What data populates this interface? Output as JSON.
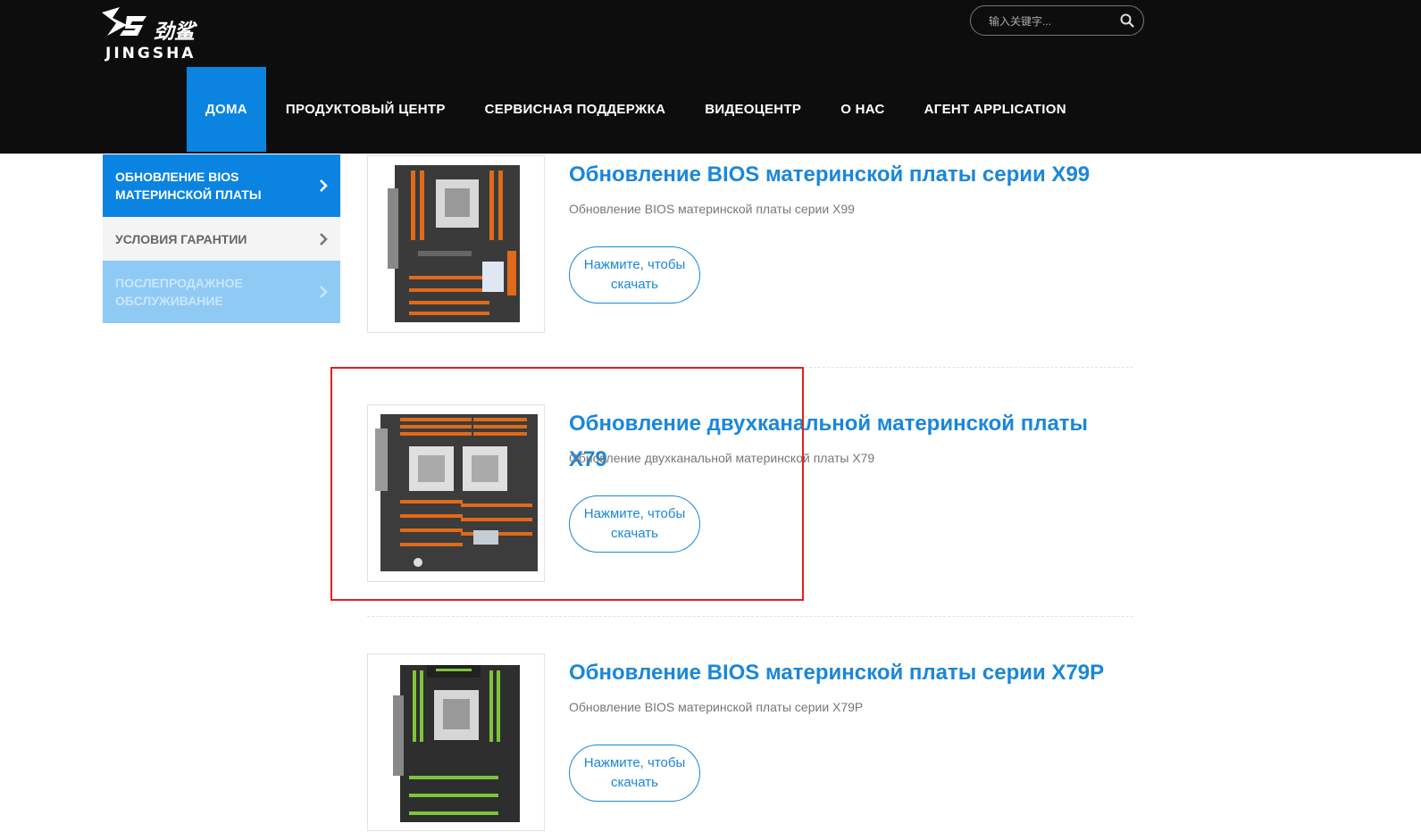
{
  "header": {
    "logo_text": "JINGSHA",
    "logo_cn": "劲鲨",
    "search_placeholder": "输入关键字..."
  },
  "nav": {
    "items": [
      {
        "label": "ДОМА"
      },
      {
        "label": "ПРОДУКТОВЫЙ ЦЕНТР"
      },
      {
        "label": "СЕРВИСНАЯ ПОДДЕРЖКА"
      },
      {
        "label": "ВИДЕОЦЕНТР"
      },
      {
        "label": "О НАС"
      },
      {
        "label": "АГЕНТ APPLICATION"
      }
    ],
    "active_index": 0
  },
  "sidebar": {
    "items": [
      {
        "label": "ОБНОВЛЕНИЕ BIOS МАТЕРИНСКОЙ ПЛАТЫ"
      },
      {
        "label": "УСЛОВИЯ ГАРАНТИИ"
      },
      {
        "label": "ПОСЛЕПРОДАЖНОЕ ОБСЛУЖИВАНИЕ"
      }
    ]
  },
  "products": [
    {
      "title": "Обновление BIOS материнской платы серии X99",
      "description": "Обновление BIOS материнской платы серии X99",
      "button": "Нажмите, чтобы скачать"
    },
    {
      "title": "Обновление двухканальной материнской платы X79",
      "description": "Обновление двухканальной материнской платы X79",
      "button": "Нажмите, чтобы скачать"
    },
    {
      "title": "Обновление BIOS материнской платы серии X79P",
      "description": "Обновление BIOS материнской платы серии X79P",
      "button": "Нажмите, чтобы скачать"
    }
  ],
  "colors": {
    "accent": "#0a84e0",
    "header_bg": "#0d0d0d",
    "title_blue": "#1a87d8",
    "annotation_red": "#e02020"
  }
}
